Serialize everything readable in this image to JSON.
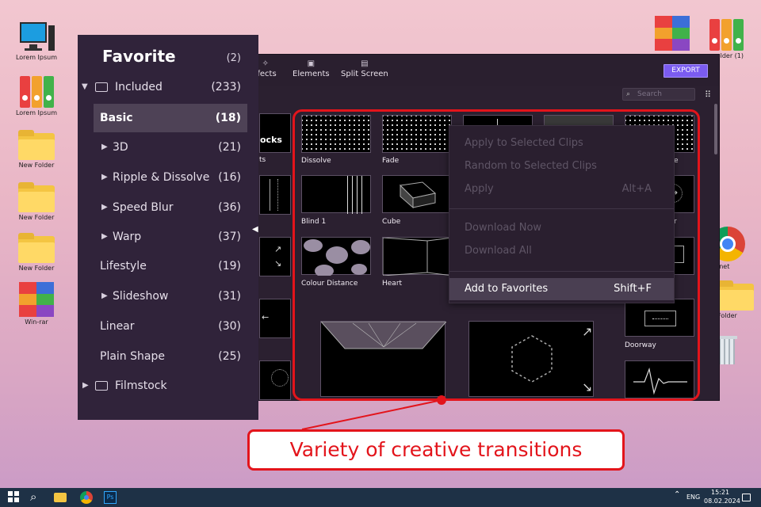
{
  "desktop": {
    "left_icons": [
      "Lorem Ipsum",
      "Lorem Ipsum",
      "New Folder",
      "New Folder",
      "New Folder",
      "Win-rar"
    ],
    "right_icons": [
      "",
      "older (1)",
      "ternet",
      "w Folder",
      ""
    ]
  },
  "editor": {
    "tabs": [
      {
        "label": "ffects",
        "icon": "effects-icon"
      },
      {
        "label": "Elements",
        "icon": "image-icon"
      },
      {
        "label": "Split Screen",
        "icon": "split-screen-icon"
      }
    ],
    "export_label": "EXPORT",
    "search_placeholder": "Search",
    "partial_labels": {
      "stocks": "ocks",
      "ts": "ts",
      "e": "e",
      "r": "r"
    },
    "thumbnails": [
      {
        "label": "Dissolve"
      },
      {
        "label": "Fade"
      },
      {
        "label": "Blind 1"
      },
      {
        "label": "Cube"
      },
      {
        "label": "Colour Distance"
      },
      {
        "label": "Heart"
      },
      {
        "label": "Doorway"
      }
    ]
  },
  "favorites_panel": {
    "title": "Favorite",
    "count": "(2)",
    "items": [
      {
        "label": "Included",
        "count": "(233)"
      },
      {
        "label": "Basic",
        "count": "(18)"
      },
      {
        "label": "3D",
        "count": "(21)"
      },
      {
        "label": "Ripple & Dissolve",
        "count": "(16)"
      },
      {
        "label": "Speed Blur",
        "count": "(36)"
      },
      {
        "label": "Warp",
        "count": "(37)"
      },
      {
        "label": "Lifestyle",
        "count": "(19)"
      },
      {
        "label": "Slideshow",
        "count": "(31)"
      },
      {
        "label": "Linear",
        "count": "(30)"
      },
      {
        "label": "Plain Shape",
        "count": "(25)"
      },
      {
        "label": "Filmstock",
        "count": ""
      }
    ]
  },
  "context_menu": {
    "items": [
      {
        "label": "Apply to Selected Clips",
        "shortcut": ""
      },
      {
        "label": "Random to Selected Clips",
        "shortcut": ""
      },
      {
        "label": "Apply",
        "shortcut": "Alt+A"
      },
      {
        "label": "Download Now",
        "shortcut": ""
      },
      {
        "label": "Download All",
        "shortcut": ""
      },
      {
        "label": "Add to Favorites",
        "shortcut": "Shift+F"
      }
    ]
  },
  "callout": "Variety of creative transitions",
  "taskbar": {
    "lang": "ENG",
    "time": "15:21",
    "date": "08.02.2024"
  },
  "colors": {
    "accent": "#7b5cf0",
    "highlight_red": "#e3141b",
    "panel_bg": "#30233a"
  }
}
